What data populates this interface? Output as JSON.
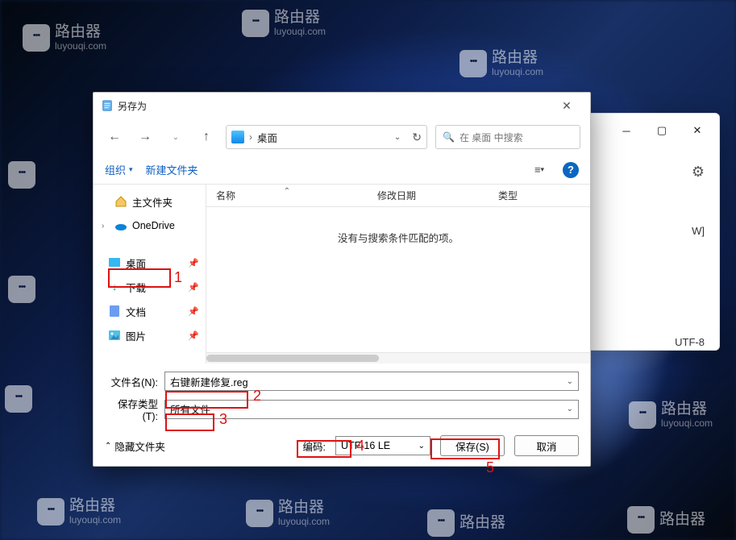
{
  "watermark": {
    "title": "路由器",
    "sub": "luyouqi.com"
  },
  "bgWindow": {
    "rightText": "W]",
    "encoding": "UTF-8"
  },
  "dialog": {
    "title": "另存为",
    "nav": {
      "location": "桌面",
      "searchPlaceholder": "在 桌面 中搜索"
    },
    "toolbar": {
      "organize": "组织",
      "newFolder": "新建文件夹"
    },
    "sidebar": {
      "home": "主文件夹",
      "onedrive": "OneDrive",
      "desktop": "桌面",
      "downloads": "下载",
      "documents": "文档",
      "pictures": "图片"
    },
    "columns": {
      "name": "名称",
      "modified": "修改日期",
      "type": "类型"
    },
    "emptyMessage": "没有与搜索条件匹配的项。",
    "form": {
      "filenameLabel": "文件名(N):",
      "filenameValue": "右键新建修复.reg",
      "typeLabel": "保存类型(T):",
      "typeValue": "所有文件",
      "encodingLabel": "编码:",
      "encodingValue": "UTF-16 LE",
      "hideFolders": "隐藏文件夹",
      "save": "保存(S)",
      "cancel": "取消"
    }
  },
  "annotations": {
    "a1": "1",
    "a2": "2",
    "a3": "3",
    "a4": "4",
    "a5": "5"
  }
}
